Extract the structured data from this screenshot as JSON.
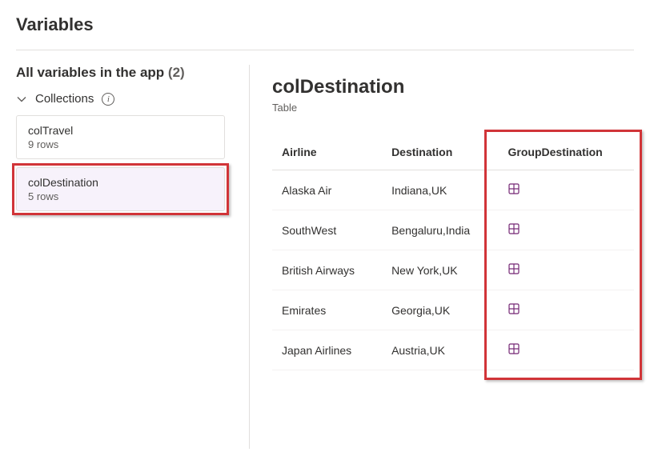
{
  "pageTitle": "Variables",
  "subheadText": "All variables in the app",
  "variableCount": "(2)",
  "sectionLabel": "Collections",
  "collections": [
    {
      "name": "colTravel",
      "rows": "9 rows",
      "selected": false
    },
    {
      "name": "colDestination",
      "rows": "5 rows",
      "selected": true
    }
  ],
  "detail": {
    "title": "colDestination",
    "subtitle": "Table"
  },
  "table": {
    "headers": [
      "Airline",
      "Destination",
      "GroupDestination"
    ],
    "rows": [
      {
        "airline": "Alaska Air",
        "destination": "Indiana,UK"
      },
      {
        "airline": "SouthWest",
        "destination": "Bengaluru,India"
      },
      {
        "airline": "British Airways",
        "destination": "New York,UK"
      },
      {
        "airline": "Emirates",
        "destination": "Georgia,UK"
      },
      {
        "airline": "Japan Airlines",
        "destination": "Austria,UK"
      }
    ]
  },
  "icons": {
    "chevron": "chevron-down-icon",
    "info": "info-icon",
    "tableCell": "table-icon"
  },
  "colors": {
    "annotation": "#d13438",
    "selectedBg": "#f7f2fb",
    "iconPurple": "#742774"
  }
}
